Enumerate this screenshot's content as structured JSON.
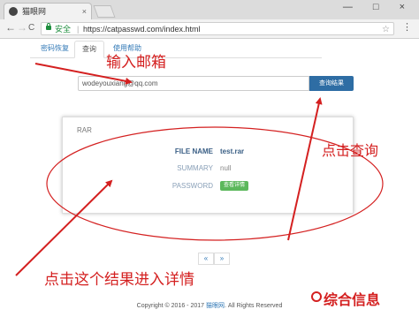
{
  "browser": {
    "tab_title": "猫眼网",
    "tab_close": "×",
    "window_controls": "— □ ×",
    "back_icon": "←",
    "forward_icon": "→",
    "reload_icon": "C",
    "secure_label": "安全",
    "address_separator": "|",
    "url": "https://catpasswd.com/index.html",
    "star_icon": "☆",
    "menu_icon": "⋮"
  },
  "nav": {
    "tabs": [
      {
        "label": "密码恢复",
        "active": false
      },
      {
        "label": "查询",
        "active": true
      },
      {
        "label": "使用帮助",
        "active": false
      }
    ]
  },
  "search": {
    "value": "wodeyouxiang@qq.com",
    "button_label": "查询结果"
  },
  "result": {
    "panel_title": "RAR",
    "rows": [
      {
        "label": "FILE NAME",
        "value": "test.rar"
      },
      {
        "label": "SUMMARY",
        "value": "null"
      },
      {
        "label": "PASSWORD",
        "value": "查看详情"
      }
    ]
  },
  "pager": {
    "prev": "«",
    "next": "»"
  },
  "footer": {
    "prefix": "Copyright © 2016 - 2017",
    "site": "猫眼网",
    "suffix": ". All Rights Reserved"
  },
  "annotations": {
    "input_email": "输入邮箱",
    "click_query": "点击查询",
    "click_result": "点击这个结果进入详情",
    "color": "#d42020"
  },
  "watermark": "综合信息"
}
